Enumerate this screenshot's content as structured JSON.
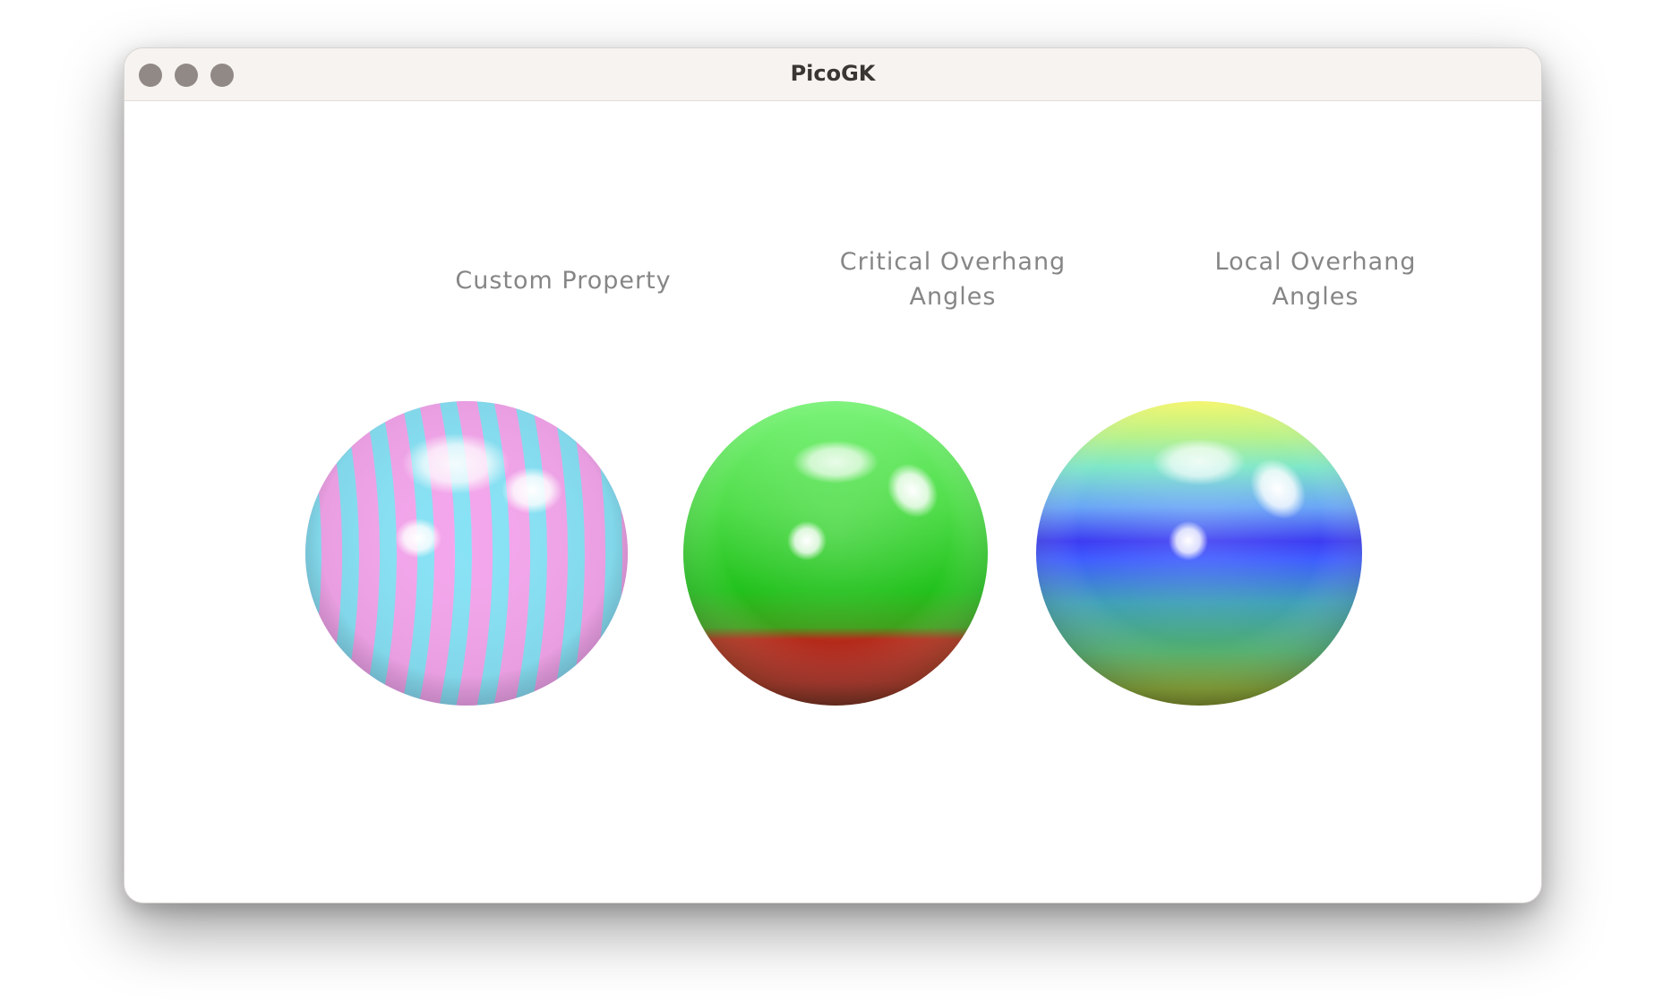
{
  "window": {
    "title": "PicoGK"
  },
  "spheres": [
    {
      "label": "Custom Property",
      "colors": [
        "#f4a6ec",
        "#7fe7f5",
        "#cf8edc"
      ]
    },
    {
      "label": "Critical Overhang Angles",
      "colors": [
        "#4ee24e",
        "#22c41e",
        "#a01f18"
      ]
    },
    {
      "label": "Local Overhang Angles",
      "colors": [
        "#f5f56a",
        "#3f5dff",
        "#3aa0a0",
        "#7d9a22"
      ]
    }
  ]
}
